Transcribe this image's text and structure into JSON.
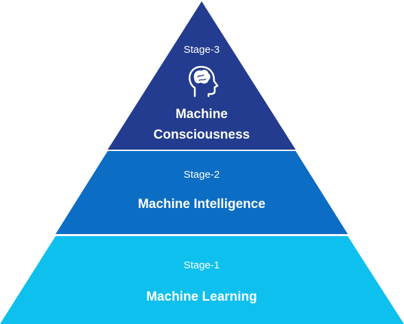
{
  "pyramid": {
    "tiers": [
      {
        "stage": "Stage-3",
        "title_lines": [
          "Machine",
          "Consciousness"
        ],
        "icon": "human-head-brain-icon",
        "color": "#233c8f"
      },
      {
        "stage": "Stage-2",
        "title_lines": [
          "Machine Intelligence"
        ],
        "color": "#0c6dc4"
      },
      {
        "stage": "Stage-1",
        "title_lines": [
          "Machine Learning"
        ],
        "color": "#0ec0ee"
      }
    ],
    "separator_color": "#ffffff"
  }
}
